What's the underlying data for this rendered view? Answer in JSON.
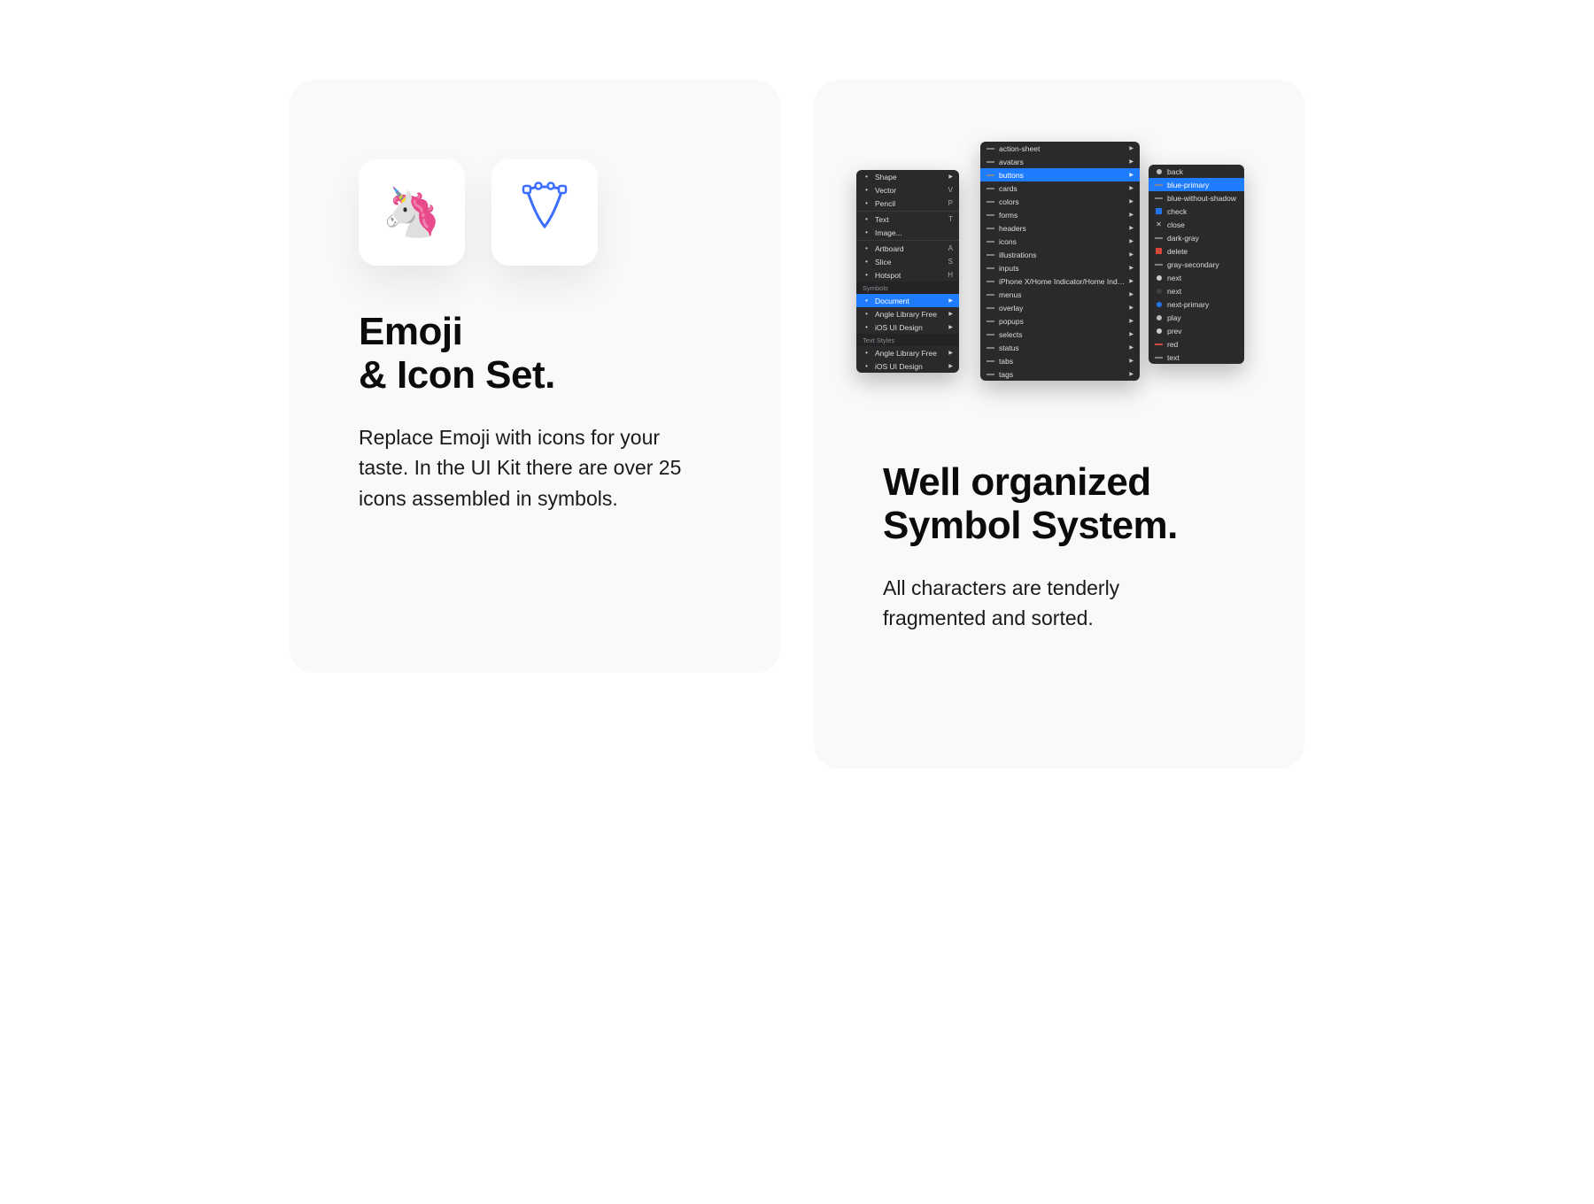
{
  "left": {
    "title_line1": "Emoji",
    "title_line2": "& Icon Set.",
    "description": "Replace Emoji with icons for your taste. In the UI Kit there are over 25 icons assembled in symbols.",
    "emoji": "🦄"
  },
  "right": {
    "title_line1": "Well organized",
    "title_line2": "Symbol System.",
    "description": "All characters are tenderly fragmented and sorted."
  },
  "panel1": {
    "group1": [
      {
        "label": "Shape",
        "shortcut": ""
      },
      {
        "label": "Vector",
        "shortcut": "V"
      },
      {
        "label": "Pencil",
        "shortcut": "P"
      }
    ],
    "group2": [
      {
        "label": "Text",
        "shortcut": "T"
      },
      {
        "label": "Image...",
        "shortcut": ""
      }
    ],
    "group3": [
      {
        "label": "Artboard",
        "shortcut": "A"
      },
      {
        "label": "Slice",
        "shortcut": "S"
      },
      {
        "label": "Hotspot",
        "shortcut": "H"
      }
    ],
    "header_symbols": "Symbols",
    "symbols": [
      {
        "label": "Document",
        "selected": true
      },
      {
        "label": "Angle Library Free"
      },
      {
        "label": "iOS UI Design"
      }
    ],
    "header_text": "Text Styles",
    "text_styles": [
      {
        "label": "Angle Library Free"
      },
      {
        "label": "iOS UI Design"
      }
    ]
  },
  "panel2": {
    "items": [
      {
        "label": "action-sheet"
      },
      {
        "label": "avatars"
      },
      {
        "label": "buttons",
        "selected": true
      },
      {
        "label": "cards"
      },
      {
        "label": "colors"
      },
      {
        "label": "forms"
      },
      {
        "label": "headers"
      },
      {
        "label": "icons"
      },
      {
        "label": "illustrations"
      },
      {
        "label": "inputs"
      },
      {
        "label": "iPhone X/Home Indicator/Home Indicator - On Light"
      },
      {
        "label": "menus"
      },
      {
        "label": "overlay"
      },
      {
        "label": "popups"
      },
      {
        "label": "selects"
      },
      {
        "label": "status"
      },
      {
        "label": "tabs"
      },
      {
        "label": "tags"
      }
    ]
  },
  "panel3": {
    "items": [
      {
        "label": "back",
        "icon": "back"
      },
      {
        "label": "blue-primary",
        "selected": true,
        "icon": "dash"
      },
      {
        "label": "blue-without-shadow",
        "icon": "dash"
      },
      {
        "label": "check",
        "icon": "check"
      },
      {
        "label": "close",
        "icon": "close"
      },
      {
        "label": "dark-gray",
        "icon": "dash"
      },
      {
        "label": "delete",
        "icon": "delete"
      },
      {
        "label": "gray-secondary",
        "icon": "dash"
      },
      {
        "label": "next",
        "icon": "dot-light"
      },
      {
        "label": "next",
        "icon": "dot-dark"
      },
      {
        "label": "next-primary",
        "icon": "dot-blue"
      },
      {
        "label": "play",
        "icon": "play"
      },
      {
        "label": "prev",
        "icon": "dot-light"
      },
      {
        "label": "red",
        "icon": "dash-red"
      },
      {
        "label": "text",
        "icon": "dash"
      }
    ]
  }
}
